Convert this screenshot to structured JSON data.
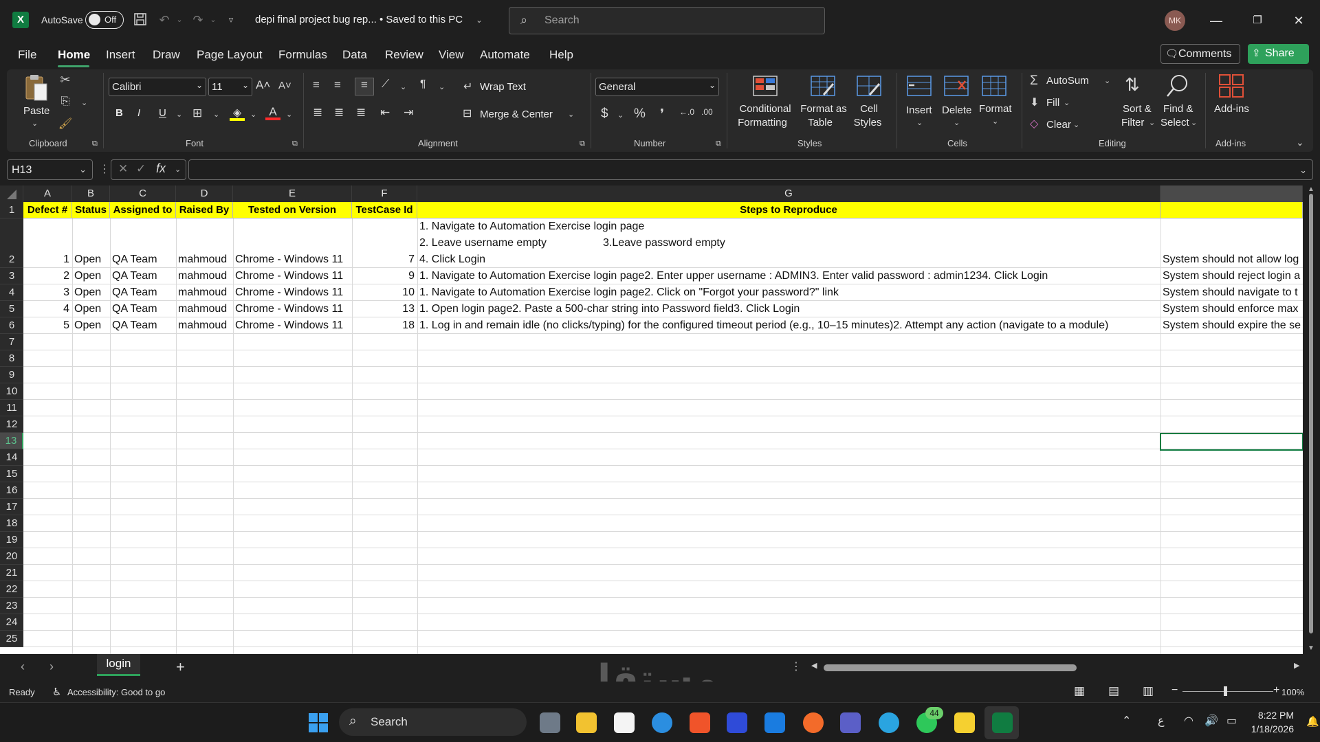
{
  "titlebar": {
    "autosave_label": "AutoSave",
    "autosave_state": "Off",
    "document_name": "depi final project bug rep... • Saved to this PC",
    "search_placeholder": "Search",
    "avatar_initials": "MK"
  },
  "menu": {
    "tabs": [
      "File",
      "Home",
      "Insert",
      "Draw",
      "Page Layout",
      "Formulas",
      "Data",
      "Review",
      "View",
      "Automate",
      "Help"
    ],
    "active_tab": "Home",
    "comments_label": "Comments",
    "share_label": "Share"
  },
  "ribbon": {
    "clipboard": {
      "paste": "Paste",
      "group": "Clipboard"
    },
    "font": {
      "name": "Calibri",
      "size": "11",
      "group": "Font",
      "bold": "B",
      "italic": "I",
      "underline": "U"
    },
    "alignment": {
      "wrap_text": "Wrap Text",
      "merge_center": "Merge & Center",
      "group": "Alignment"
    },
    "number": {
      "format": "General",
      "group": "Number"
    },
    "styles": {
      "conditional": [
        "Conditional",
        "Formatting"
      ],
      "format_table": [
        "Format as",
        "Table"
      ],
      "cell_styles": [
        "Cell",
        "Styles"
      ],
      "group": "Styles"
    },
    "cells": {
      "insert": "Insert",
      "delete": "Delete",
      "format": "Format",
      "group": "Cells"
    },
    "editing": {
      "autosum": "AutoSum",
      "fill": "Fill",
      "clear": "Clear",
      "sort_filter": [
        "Sort &",
        "Filter"
      ],
      "find_select": [
        "Find &",
        "Select"
      ],
      "group": "Editing"
    },
    "addins": {
      "label": "Add-ins",
      "group": "Add-ins"
    }
  },
  "formula_bar": {
    "name_box": "H13",
    "formula": ""
  },
  "sheet": {
    "column_headers": [
      "A",
      "B",
      "C",
      "D",
      "E",
      "F",
      "G",
      ""
    ],
    "row_numbers": [
      "1",
      "2",
      "3",
      "4",
      "5",
      "6",
      "7",
      "8",
      "9",
      "10",
      "11",
      "12",
      "13",
      "14",
      "15",
      "16",
      "17",
      "18",
      "19",
      "20",
      "21",
      "22",
      "23",
      "24",
      "25"
    ],
    "selected_row": "13",
    "header_row": [
      "Defect #",
      "Status",
      "Assigned to",
      "Raised By",
      "Tested on Version",
      "TestCase Id",
      "Steps to Reproduce",
      ""
    ],
    "row2_steps": [
      "1. Navigate to Automation Exercise login page",
      "2. Leave username empty",
      "3.Leave password empty",
      "4. Click Login"
    ],
    "rows": [
      {
        "defect": "1",
        "status": "Open",
        "assigned": "QA Team",
        "raised": "mahmoud",
        "version": "Chrome - Windows 11",
        "tc": "7",
        "steps": "4. Click Login",
        "expected": "System should not allow log"
      },
      {
        "defect": "2",
        "status": "Open",
        "assigned": "QA Team",
        "raised": "mahmoud",
        "version": "Chrome - Windows 11",
        "tc": "9",
        "steps": "1. Navigate to Automation Exercise login page2. Enter upper username : ADMIN3. Enter valid password : admin1234. Click Login",
        "expected": "System should reject login a"
      },
      {
        "defect": "3",
        "status": "Open",
        "assigned": "QA Team",
        "raised": "mahmoud",
        "version": "Chrome - Windows 11",
        "tc": "10",
        "steps": "1. Navigate to Automation Exercise login page2. Click on \"Forgot your password?\" link",
        "expected": "System should navigate to t"
      },
      {
        "defect": "4",
        "status": "Open",
        "assigned": "QA Team",
        "raised": "mahmoud",
        "version": "Chrome - Windows 11",
        "tc": "13",
        "steps": "1. Open login page2. Paste a 500-char string into Password field3. Click Login",
        "expected": "System should enforce max"
      },
      {
        "defect": "5",
        "status": "Open",
        "assigned": "QA Team",
        "raised": "mahmoud",
        "version": "Chrome - Windows 11",
        "tc": "18",
        "steps": "1. Log in and remain idle (no clicks/typing) for the configured timeout period (e.g., 10–15 minutes)2. Attempt any action (navigate to a module)",
        "expected": "System should expire the se"
      }
    ]
  },
  "sheet_tabs": {
    "active": "login",
    "add": "+"
  },
  "status_bar": {
    "ready": "Ready",
    "accessibility": "Accessibility: Good to go",
    "zoom": "100%"
  },
  "taskbar": {
    "search_label": "Search",
    "whatsapp_badge": "44",
    "time": "8:22 PM",
    "date": "1/18/2026",
    "lang": "ع"
  },
  "watermark": "مستقل"
}
